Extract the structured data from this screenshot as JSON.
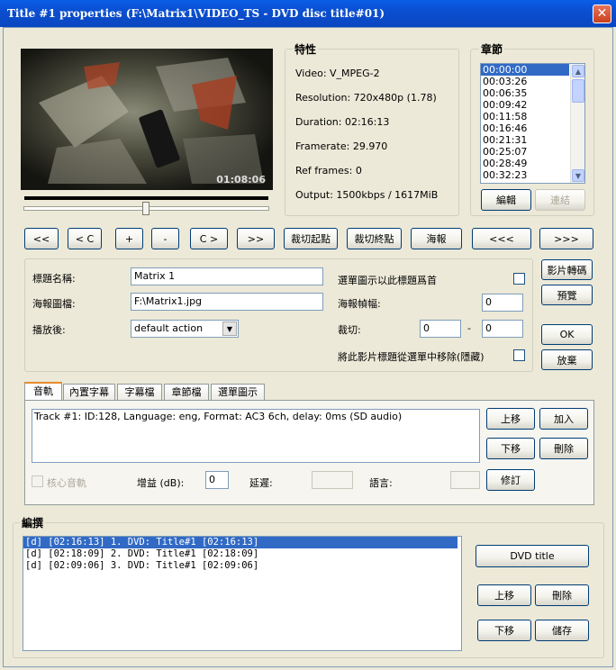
{
  "window": {
    "title": "Title #1 properties (F:\\Matrix1\\VIDEO_TS - DVD disc title#01)",
    "close_glyph": "✕"
  },
  "preview": {
    "timecode": "01:08:06"
  },
  "properties": {
    "title": "特性",
    "lines": [
      "Video: V_MPEG-2",
      "Resolution: 720x480p (1.78)",
      "Duration: 02:16:13",
      "Framerate: 29.970",
      "Ref frames: 0",
      "Output: 1500kbps / 1617MiB"
    ]
  },
  "chapters": {
    "title": "章節",
    "items": [
      "00:00:00",
      "00:03:26",
      "00:06:35",
      "00:09:42",
      "00:11:58",
      "00:16:46",
      "00:21:31",
      "00:25:07",
      "00:28:49",
      "00:32:23"
    ],
    "edit_label": "編輯",
    "link_label": "連結"
  },
  "nav_buttons": [
    "<<",
    "< C",
    "+",
    "-",
    "C >",
    ">>",
    "裁切起點",
    "裁切終點",
    "海報",
    "<<<",
    ">>>"
  ],
  "form": {
    "title_label": "標題名稱:",
    "title_value": "Matrix 1",
    "poster_label": "海報圖檔:",
    "poster_value": "F:\\Matrix1.jpg",
    "after_label": "播放後:",
    "after_value": "default action",
    "menu_first_label": "選單圖示以此標題爲首",
    "poster_frame_label": "海報幀幅:",
    "poster_frame_value": "0",
    "crop_label": "裁切:",
    "crop_from": "0",
    "crop_dash": "-",
    "crop_to": "0",
    "hide_label": "將此影片標題從選單中移除(隱藏)"
  },
  "side_buttons": {
    "convert": "影片轉碼",
    "preview": "預覽",
    "ok": "OK",
    "cancel": "放棄"
  },
  "tabs": [
    "音軌",
    "內置字幕",
    "字幕檔",
    "章節檔",
    "選單圖示"
  ],
  "audio": {
    "tracks": [
      "Track #1: ID:128, Language: eng, Format: AC3 6ch, delay: 0ms (SD audio)"
    ],
    "up": "上移",
    "add": "加入",
    "down": "下移",
    "delete": "刪除",
    "core_label": "核心音軌",
    "gain_label": "增益 (dB):",
    "gain_value": "0",
    "delay_label": "延遲:",
    "delay_value": "",
    "lang_label": "語言:",
    "lang_value": "",
    "modify": "修訂"
  },
  "compose": {
    "title": "編撰",
    "items": [
      "[d] [02:16:13] 1. DVD: Title#1 [02:16:13]",
      "[d] [02:18:09] 2. DVD: Title#1 [02:18:09]",
      "[d] [02:09:06] 3. DVD: Title#1 [02:09:06]"
    ],
    "dvd_title": "DVD title",
    "up": "上移",
    "delete": "刪除",
    "down": "下移",
    "save": "儲存"
  }
}
